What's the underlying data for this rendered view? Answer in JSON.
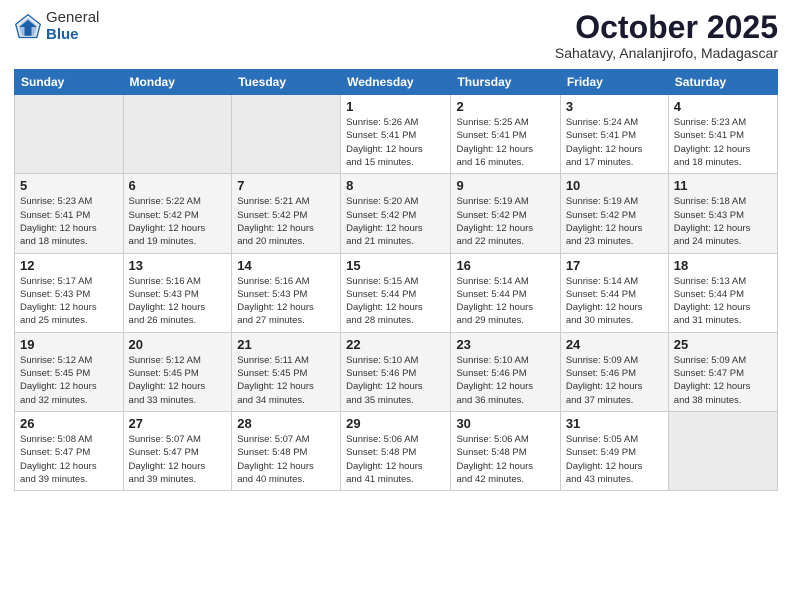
{
  "header": {
    "logo_general": "General",
    "logo_blue": "Blue",
    "month_title": "October 2025",
    "subtitle": "Sahatavy, Analanjirofo, Madagascar"
  },
  "weekdays": [
    "Sunday",
    "Monday",
    "Tuesday",
    "Wednesday",
    "Thursday",
    "Friday",
    "Saturday"
  ],
  "rows": [
    [
      {
        "day": "",
        "info": ""
      },
      {
        "day": "",
        "info": ""
      },
      {
        "day": "",
        "info": ""
      },
      {
        "day": "1",
        "info": "Sunrise: 5:26 AM\nSunset: 5:41 PM\nDaylight: 12 hours\nand 15 minutes."
      },
      {
        "day": "2",
        "info": "Sunrise: 5:25 AM\nSunset: 5:41 PM\nDaylight: 12 hours\nand 16 minutes."
      },
      {
        "day": "3",
        "info": "Sunrise: 5:24 AM\nSunset: 5:41 PM\nDaylight: 12 hours\nand 17 minutes."
      },
      {
        "day": "4",
        "info": "Sunrise: 5:23 AM\nSunset: 5:41 PM\nDaylight: 12 hours\nand 18 minutes."
      }
    ],
    [
      {
        "day": "5",
        "info": "Sunrise: 5:23 AM\nSunset: 5:41 PM\nDaylight: 12 hours\nand 18 minutes."
      },
      {
        "day": "6",
        "info": "Sunrise: 5:22 AM\nSunset: 5:42 PM\nDaylight: 12 hours\nand 19 minutes."
      },
      {
        "day": "7",
        "info": "Sunrise: 5:21 AM\nSunset: 5:42 PM\nDaylight: 12 hours\nand 20 minutes."
      },
      {
        "day": "8",
        "info": "Sunrise: 5:20 AM\nSunset: 5:42 PM\nDaylight: 12 hours\nand 21 minutes."
      },
      {
        "day": "9",
        "info": "Sunrise: 5:19 AM\nSunset: 5:42 PM\nDaylight: 12 hours\nand 22 minutes."
      },
      {
        "day": "10",
        "info": "Sunrise: 5:19 AM\nSunset: 5:42 PM\nDaylight: 12 hours\nand 23 minutes."
      },
      {
        "day": "11",
        "info": "Sunrise: 5:18 AM\nSunset: 5:43 PM\nDaylight: 12 hours\nand 24 minutes."
      }
    ],
    [
      {
        "day": "12",
        "info": "Sunrise: 5:17 AM\nSunset: 5:43 PM\nDaylight: 12 hours\nand 25 minutes."
      },
      {
        "day": "13",
        "info": "Sunrise: 5:16 AM\nSunset: 5:43 PM\nDaylight: 12 hours\nand 26 minutes."
      },
      {
        "day": "14",
        "info": "Sunrise: 5:16 AM\nSunset: 5:43 PM\nDaylight: 12 hours\nand 27 minutes."
      },
      {
        "day": "15",
        "info": "Sunrise: 5:15 AM\nSunset: 5:44 PM\nDaylight: 12 hours\nand 28 minutes."
      },
      {
        "day": "16",
        "info": "Sunrise: 5:14 AM\nSunset: 5:44 PM\nDaylight: 12 hours\nand 29 minutes."
      },
      {
        "day": "17",
        "info": "Sunrise: 5:14 AM\nSunset: 5:44 PM\nDaylight: 12 hours\nand 30 minutes."
      },
      {
        "day": "18",
        "info": "Sunrise: 5:13 AM\nSunset: 5:44 PM\nDaylight: 12 hours\nand 31 minutes."
      }
    ],
    [
      {
        "day": "19",
        "info": "Sunrise: 5:12 AM\nSunset: 5:45 PM\nDaylight: 12 hours\nand 32 minutes."
      },
      {
        "day": "20",
        "info": "Sunrise: 5:12 AM\nSunset: 5:45 PM\nDaylight: 12 hours\nand 33 minutes."
      },
      {
        "day": "21",
        "info": "Sunrise: 5:11 AM\nSunset: 5:45 PM\nDaylight: 12 hours\nand 34 minutes."
      },
      {
        "day": "22",
        "info": "Sunrise: 5:10 AM\nSunset: 5:46 PM\nDaylight: 12 hours\nand 35 minutes."
      },
      {
        "day": "23",
        "info": "Sunrise: 5:10 AM\nSunset: 5:46 PM\nDaylight: 12 hours\nand 36 minutes."
      },
      {
        "day": "24",
        "info": "Sunrise: 5:09 AM\nSunset: 5:46 PM\nDaylight: 12 hours\nand 37 minutes."
      },
      {
        "day": "25",
        "info": "Sunrise: 5:09 AM\nSunset: 5:47 PM\nDaylight: 12 hours\nand 38 minutes."
      }
    ],
    [
      {
        "day": "26",
        "info": "Sunrise: 5:08 AM\nSunset: 5:47 PM\nDaylight: 12 hours\nand 39 minutes."
      },
      {
        "day": "27",
        "info": "Sunrise: 5:07 AM\nSunset: 5:47 PM\nDaylight: 12 hours\nand 39 minutes."
      },
      {
        "day": "28",
        "info": "Sunrise: 5:07 AM\nSunset: 5:48 PM\nDaylight: 12 hours\nand 40 minutes."
      },
      {
        "day": "29",
        "info": "Sunrise: 5:06 AM\nSunset: 5:48 PM\nDaylight: 12 hours\nand 41 minutes."
      },
      {
        "day": "30",
        "info": "Sunrise: 5:06 AM\nSunset: 5:48 PM\nDaylight: 12 hours\nand 42 minutes."
      },
      {
        "day": "31",
        "info": "Sunrise: 5:05 AM\nSunset: 5:49 PM\nDaylight: 12 hours\nand 43 minutes."
      },
      {
        "day": "",
        "info": ""
      }
    ]
  ]
}
